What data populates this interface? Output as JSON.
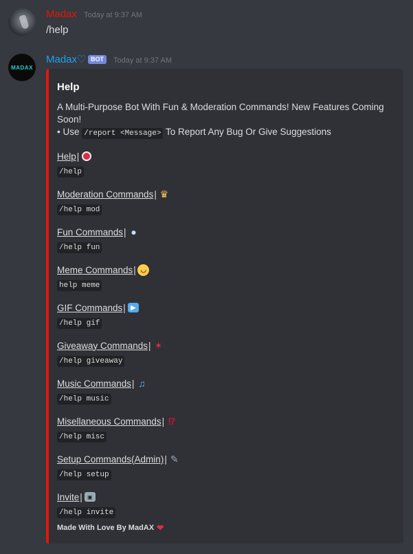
{
  "message1": {
    "username": "Madax",
    "username_color": "#e3170a",
    "timestamp": "Today at 9:37 AM",
    "content": "/help"
  },
  "message2": {
    "username": "Madax♡",
    "username_color": "#1da1f2",
    "badge": "BOT",
    "timestamp": "Today at 9:37 AM",
    "avatar_text": "MADAX",
    "embed": {
      "color": "#e3170a",
      "title": "Help",
      "description_line1": "A Multi-Purpose Bot With Fun & Moderation Commands! New Features Coming Soon!",
      "description_bullet": "• Use ",
      "description_code": "/report <Message>",
      "description_tail": " To Report Any Bug Or Give Suggestions",
      "fields": [
        {
          "name": "Help",
          "emoji": "help-emoji",
          "value": "/help"
        },
        {
          "name": "Moderation Commands",
          "emoji": "crown-emoji",
          "value": "/help mod"
        },
        {
          "name": "Fun Commands",
          "emoji": "speech-bubble-emoji",
          "value": "/help fun"
        },
        {
          "name": "Meme Commands",
          "emoji": "laughing-face-emoji",
          "value": "help meme"
        },
        {
          "name": "GIF Commands",
          "emoji": "movie-camera-emoji",
          "value": "/help gif"
        },
        {
          "name": "Giveaway Commands",
          "emoji": "party-popper-emoji",
          "value": "/help giveaway"
        },
        {
          "name": "Music Commands",
          "emoji": "musical-note-emoji",
          "value": "/help music"
        },
        {
          "name": "Misellaneous Commands",
          "emoji": "interrobang-emoji",
          "value": "/help misc"
        },
        {
          "name": "Setup Commands(Admin)",
          "emoji": "wrench-emoji",
          "value": "/help setup"
        },
        {
          "name": "Invite",
          "emoji": "robot-emoji",
          "value": "/help invite"
        }
      ],
      "footer": "Made With Love By MadAX",
      "footer_emoji": "❤"
    }
  }
}
